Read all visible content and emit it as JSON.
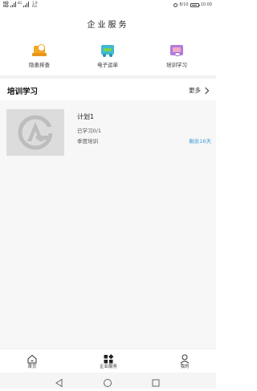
{
  "statusbar": {
    "left_hd1": "HD",
    "left_hd2": "HD",
    "left_net": "4G",
    "right_text": "8/10",
    "time": "10:00",
    "network_speed": "1.9 K/s"
  },
  "page": {
    "title": "企业服务"
  },
  "quick_actions": [
    {
      "label": "隐患排查",
      "icon": "hazard-check-icon"
    },
    {
      "label": "电子运单",
      "icon": "e-waybill-icon"
    },
    {
      "label": "培训学习",
      "icon": "training-icon"
    }
  ],
  "training": {
    "title": "培训学习",
    "more": "更多",
    "courses": [
      {
        "name": "计划1",
        "progress": "已学习0/1",
        "category": "季度培训",
        "remaining": "剩余16天"
      }
    ]
  },
  "tabbar": {
    "items": [
      {
        "label": "首页",
        "icon": "home-icon"
      },
      {
        "label": "企业服务",
        "icon": "enterprise-service-icon"
      },
      {
        "label": "我的",
        "icon": "profile-icon"
      }
    ]
  },
  "navbar": {
    "back": "back-icon",
    "home": "home-circle-icon",
    "recent": "recent-apps-icon"
  },
  "colors": {
    "accent_blue": "#3a9bd5",
    "hazard_orange": "#f5a623",
    "waybill_blue": "#3fb9d8",
    "training_purple": "#b07ce0"
  }
}
